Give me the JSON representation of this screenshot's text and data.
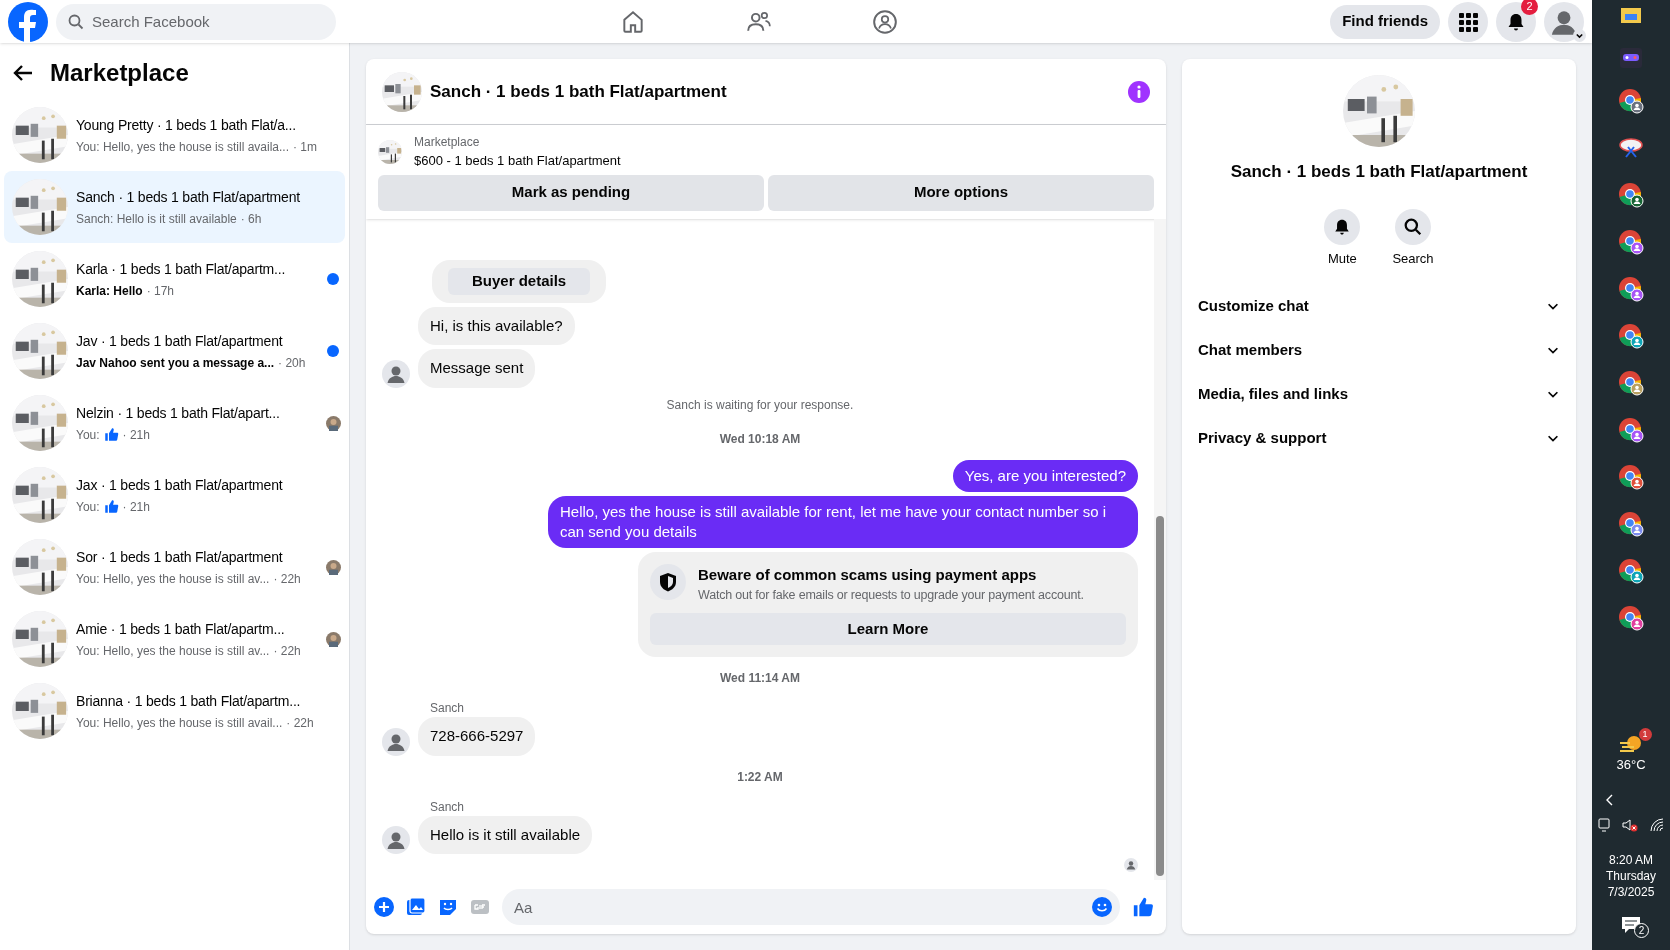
{
  "top_bar": {
    "search": {
      "placeholder": "Search Facebook"
    },
    "find_friends": "Find friends",
    "notification_count": "2"
  },
  "sidebar": {
    "title": "Marketplace",
    "conversations": [
      {
        "title": "Young Pretty · 1 beds 1 bath Flat/a...",
        "preview": "You: Hello, yes the house is still availa...",
        "like": false,
        "time": "· 1m",
        "selected": false,
        "unread": false,
        "seen_avatar": false
      },
      {
        "title": "Sanch · 1 beds 1 bath Flat/apartment",
        "preview": "Sanch: Hello is it still available",
        "like": false,
        "time": "· 6h",
        "selected": true,
        "unread": false,
        "seen_avatar": false
      },
      {
        "title": "Karla · 1 beds 1 bath Flat/apartm...",
        "preview": "Karla: Hello",
        "like": false,
        "time": "· 17h",
        "selected": false,
        "unread": true,
        "seen_avatar": false
      },
      {
        "title": "Jav · 1 beds 1 bath Flat/apartment",
        "preview": "Jav Nahoo sent you a message a...",
        "like": false,
        "time": "· 20h",
        "selected": false,
        "unread": true,
        "seen_avatar": false
      },
      {
        "title": "Nelzin · 1 beds 1 bath Flat/apart...",
        "preview": "You:",
        "like": true,
        "time": "· 21h",
        "selected": false,
        "unread": false,
        "seen_avatar": true
      },
      {
        "title": "Jax · 1 beds 1 bath Flat/apartment",
        "preview": "You:",
        "like": true,
        "time": "· 21h",
        "selected": false,
        "unread": false,
        "seen_avatar": false
      },
      {
        "title": "Sor · 1 beds 1 bath Flat/apartment",
        "preview": "You: Hello, yes the house is still av...",
        "like": false,
        "time": "· 22h",
        "selected": false,
        "unread": false,
        "seen_avatar": true
      },
      {
        "title": "Amie · 1 beds 1 bath Flat/apartm...",
        "preview": "You: Hello, yes the house is still av...",
        "like": false,
        "time": "· 22h",
        "selected": false,
        "unread": false,
        "seen_avatar": true
      },
      {
        "title": "Brianna · 1 beds 1 bath Flat/apartm...",
        "preview": "You: Hello, yes the house is still avail...",
        "like": false,
        "time": "· 22h",
        "selected": false,
        "unread": false,
        "seen_avatar": false
      }
    ]
  },
  "chat": {
    "title": "Sanch · 1 beds 1 bath Flat/apartment",
    "listing": {
      "label": "Marketplace",
      "title": "$600 - 1 beds 1 bath Flat/apartment"
    },
    "actions": [
      "Mark as pending",
      "More options"
    ],
    "messages": [
      {
        "kind": "button",
        "text": "Buyer details"
      },
      {
        "kind": "in",
        "text": "Hi, is this available?",
        "avatar": false
      },
      {
        "kind": "in",
        "text": "Message sent",
        "avatar": true
      },
      {
        "kind": "status",
        "text": "Sanch is waiting for your response."
      },
      {
        "kind": "time",
        "text": "Wed 10:18 AM"
      },
      {
        "kind": "out",
        "text": "Yes, are you interested?"
      },
      {
        "kind": "out",
        "text": "Hello, yes the house is still available for rent, let me have your contact number so i can send you details"
      },
      {
        "kind": "notice",
        "title": "Beware of common scams using payment apps",
        "body": "Watch out for fake emails or requests to upgrade your payment account.",
        "button": "Learn More"
      },
      {
        "kind": "time",
        "text": "Wed 11:14 AM"
      },
      {
        "kind": "sender",
        "text": "Sanch"
      },
      {
        "kind": "in",
        "text": "728-666-5297",
        "avatar": true
      },
      {
        "kind": "time",
        "text": "1:22 AM"
      },
      {
        "kind": "sender",
        "text": "Sanch"
      },
      {
        "kind": "in",
        "text": "Hello is it still available",
        "avatar": true
      }
    ],
    "composer": {
      "placeholder": "Aa"
    }
  },
  "details": {
    "title": "Sanch · 1 beds 1 bath Flat/apartment",
    "actions": [
      {
        "kind": "mute",
        "label": "Mute"
      },
      {
        "kind": "search",
        "label": "Search"
      }
    ],
    "sections": [
      "Customize chat",
      "Chat members",
      "Media, files and links",
      "Privacy & support"
    ]
  },
  "taskbar": {
    "weather_badge": "1",
    "temperature": "36°C",
    "time": "8:20 AM",
    "day": "Thursday",
    "date": "7/3/2025",
    "notification_count": "2"
  }
}
